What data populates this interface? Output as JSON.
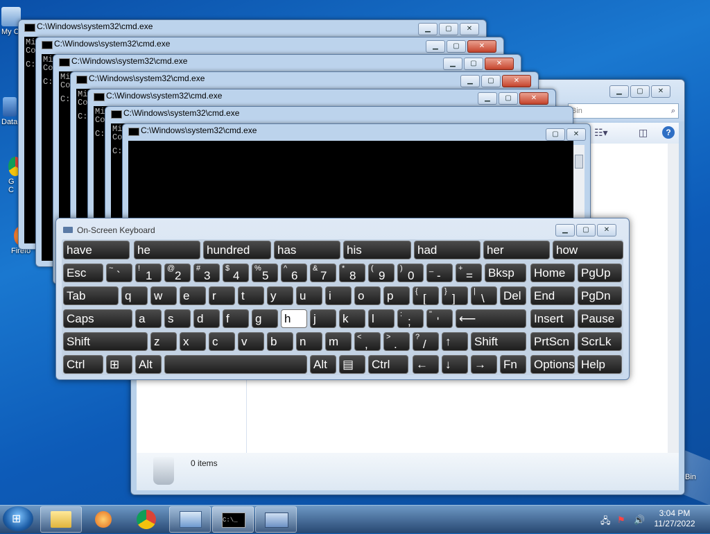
{
  "desktop": {
    "icons": [
      {
        "label": "My C"
      },
      {
        "label": "Data"
      },
      {
        "label": "G"
      },
      {
        "label": "C"
      },
      {
        "label": "Firefo"
      }
    ],
    "bin_label": "Bin"
  },
  "explorer": {
    "search_placeholder": "Bin",
    "status_items": "0 items"
  },
  "cmd": {
    "title": "C:\\Windows\\system32\\cmd.exe",
    "line1": "Mi",
    "line2": "Co",
    "line3": "C:"
  },
  "osk": {
    "title": "On-Screen Keyboard",
    "suggestions": [
      "have",
      "he",
      "hundred",
      "has",
      "his",
      "had",
      "her",
      "how"
    ],
    "rows": {
      "r1": [
        {
          "m": "Esc"
        },
        {
          "s": "~",
          "m": "`"
        },
        {
          "s": "!",
          "m": "1"
        },
        {
          "s": "@",
          "m": "2"
        },
        {
          "s": "#",
          "m": "3"
        },
        {
          "s": "$",
          "m": "4"
        },
        {
          "s": "%",
          "m": "5"
        },
        {
          "s": "^",
          "m": "6"
        },
        {
          "s": "&",
          "m": "7"
        },
        {
          "s": "*",
          "m": "8"
        },
        {
          "s": "(",
          "m": "9"
        },
        {
          "s": ")",
          "m": "0"
        },
        {
          "s": "_",
          "m": "-"
        },
        {
          "s": "+",
          "m": "="
        },
        {
          "m": "Bksp"
        },
        {
          "m": "Home"
        },
        {
          "m": "PgUp"
        }
      ],
      "r2": [
        {
          "m": "Tab"
        },
        {
          "m": "q"
        },
        {
          "m": "w"
        },
        {
          "m": "e"
        },
        {
          "m": "r"
        },
        {
          "m": "t"
        },
        {
          "m": "y"
        },
        {
          "m": "u"
        },
        {
          "m": "i"
        },
        {
          "m": "o"
        },
        {
          "m": "p"
        },
        {
          "s": "{",
          "m": "["
        },
        {
          "s": "}",
          "m": "]"
        },
        {
          "s": "|",
          "m": "\\"
        },
        {
          "m": "Del"
        },
        {
          "m": "End"
        },
        {
          "m": "PgDn"
        }
      ],
      "r3": [
        {
          "m": "Caps"
        },
        {
          "m": "a"
        },
        {
          "m": "s"
        },
        {
          "m": "d"
        },
        {
          "m": "f"
        },
        {
          "m": "g"
        },
        {
          "m": "h"
        },
        {
          "m": "j"
        },
        {
          "m": "k"
        },
        {
          "m": "l"
        },
        {
          "s": ":",
          "m": ";"
        },
        {
          "s": "\"",
          "m": "'"
        },
        {
          "m": "⟵"
        },
        {
          "m": "Insert"
        },
        {
          "m": "Pause"
        }
      ],
      "r4": [
        {
          "m": "Shift"
        },
        {
          "m": "z"
        },
        {
          "m": "x"
        },
        {
          "m": "c"
        },
        {
          "m": "v"
        },
        {
          "m": "b"
        },
        {
          "m": "n"
        },
        {
          "m": "m"
        },
        {
          "s": "<",
          "m": ","
        },
        {
          "s": ">",
          "m": "."
        },
        {
          "s": "?",
          "m": "/"
        },
        {
          "m": "↑"
        },
        {
          "m": "Shift"
        },
        {
          "m": "PrtScn"
        },
        {
          "m": "ScrLk"
        }
      ],
      "r5": [
        {
          "m": "Ctrl"
        },
        {
          "m": "⊞"
        },
        {
          "m": "Alt"
        },
        {
          "m": ""
        },
        {
          "m": "Alt"
        },
        {
          "m": "▤"
        },
        {
          "m": "Ctrl"
        },
        {
          "m": "←"
        },
        {
          "m": "↓"
        },
        {
          "m": "→"
        },
        {
          "m": "Fn"
        },
        {
          "m": "Options"
        },
        {
          "m": "Help"
        }
      ]
    }
  },
  "taskbar": {
    "time": "3:04 PM",
    "date": "11/27/2022"
  }
}
